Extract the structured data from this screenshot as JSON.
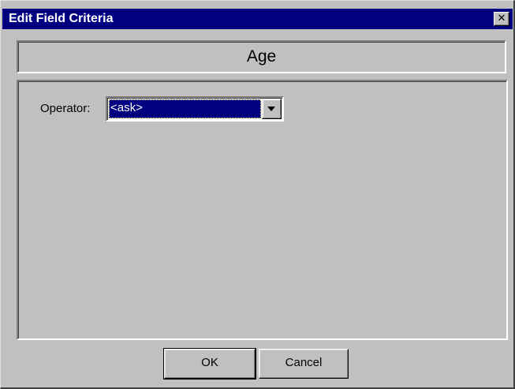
{
  "window": {
    "title": "Edit Field Criteria",
    "close_glyph": "✕",
    "close_icon": "close-icon"
  },
  "header": {
    "field_name": "Age"
  },
  "form": {
    "operator_label": "Operator:",
    "operator_value": "<ask>",
    "dropdown_icon": "chevron-down-icon"
  },
  "buttons": {
    "ok_label": "OK",
    "cancel_label": "Cancel"
  },
  "colors": {
    "titlebar": "#000080",
    "face": "#c0c0c0",
    "selection": "#000080"
  }
}
